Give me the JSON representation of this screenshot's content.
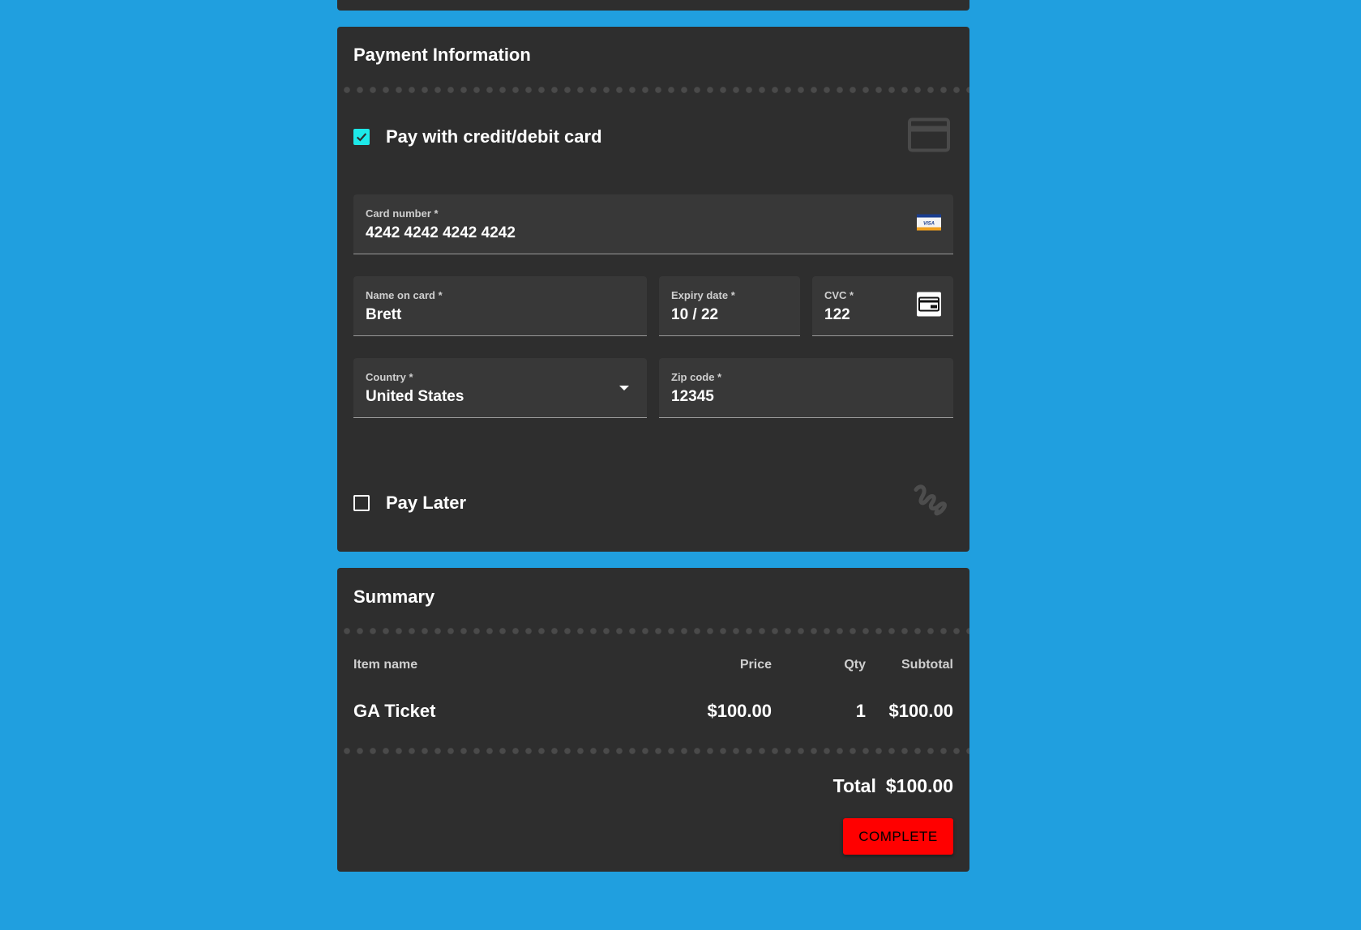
{
  "colors": {
    "background": "#209fdf",
    "card": "#2e2e2e",
    "field": "#383838",
    "checkbox_accent": "#1de9e9",
    "primary_button": "#ff0000"
  },
  "payment": {
    "title": "Payment Information",
    "card_option": {
      "label": "Pay with credit/debit card",
      "checked": true,
      "icon": "credit-card-icon"
    },
    "fields": {
      "card_number": {
        "label": "Card number *",
        "value": "4242 4242 4242 4242",
        "icon": "visa-icon"
      },
      "name_on_card": {
        "label": "Name on card *",
        "value": "Brett"
      },
      "expiry": {
        "label": "Expiry date *",
        "value": "10 / 22"
      },
      "cvc": {
        "label": "CVC *",
        "value": "122",
        "icon": "cvc-card-icon"
      },
      "country": {
        "label": "Country *",
        "value": "United States",
        "icon": "dropdown-arrow-icon"
      },
      "zip": {
        "label": "Zip code *",
        "value": "12345"
      }
    },
    "later_option": {
      "label": "Pay Later",
      "checked": false,
      "icon": "pay-later-icon"
    }
  },
  "summary": {
    "title": "Summary",
    "columns": [
      "Item name",
      "Price",
      "Qty",
      "Subtotal"
    ],
    "items": [
      {
        "name": "GA Ticket",
        "price": "$100.00",
        "qty": "1",
        "subtotal": "$100.00"
      }
    ],
    "total_label": "Total",
    "total_value": "$100.00",
    "complete_label": "COMPLETE"
  }
}
